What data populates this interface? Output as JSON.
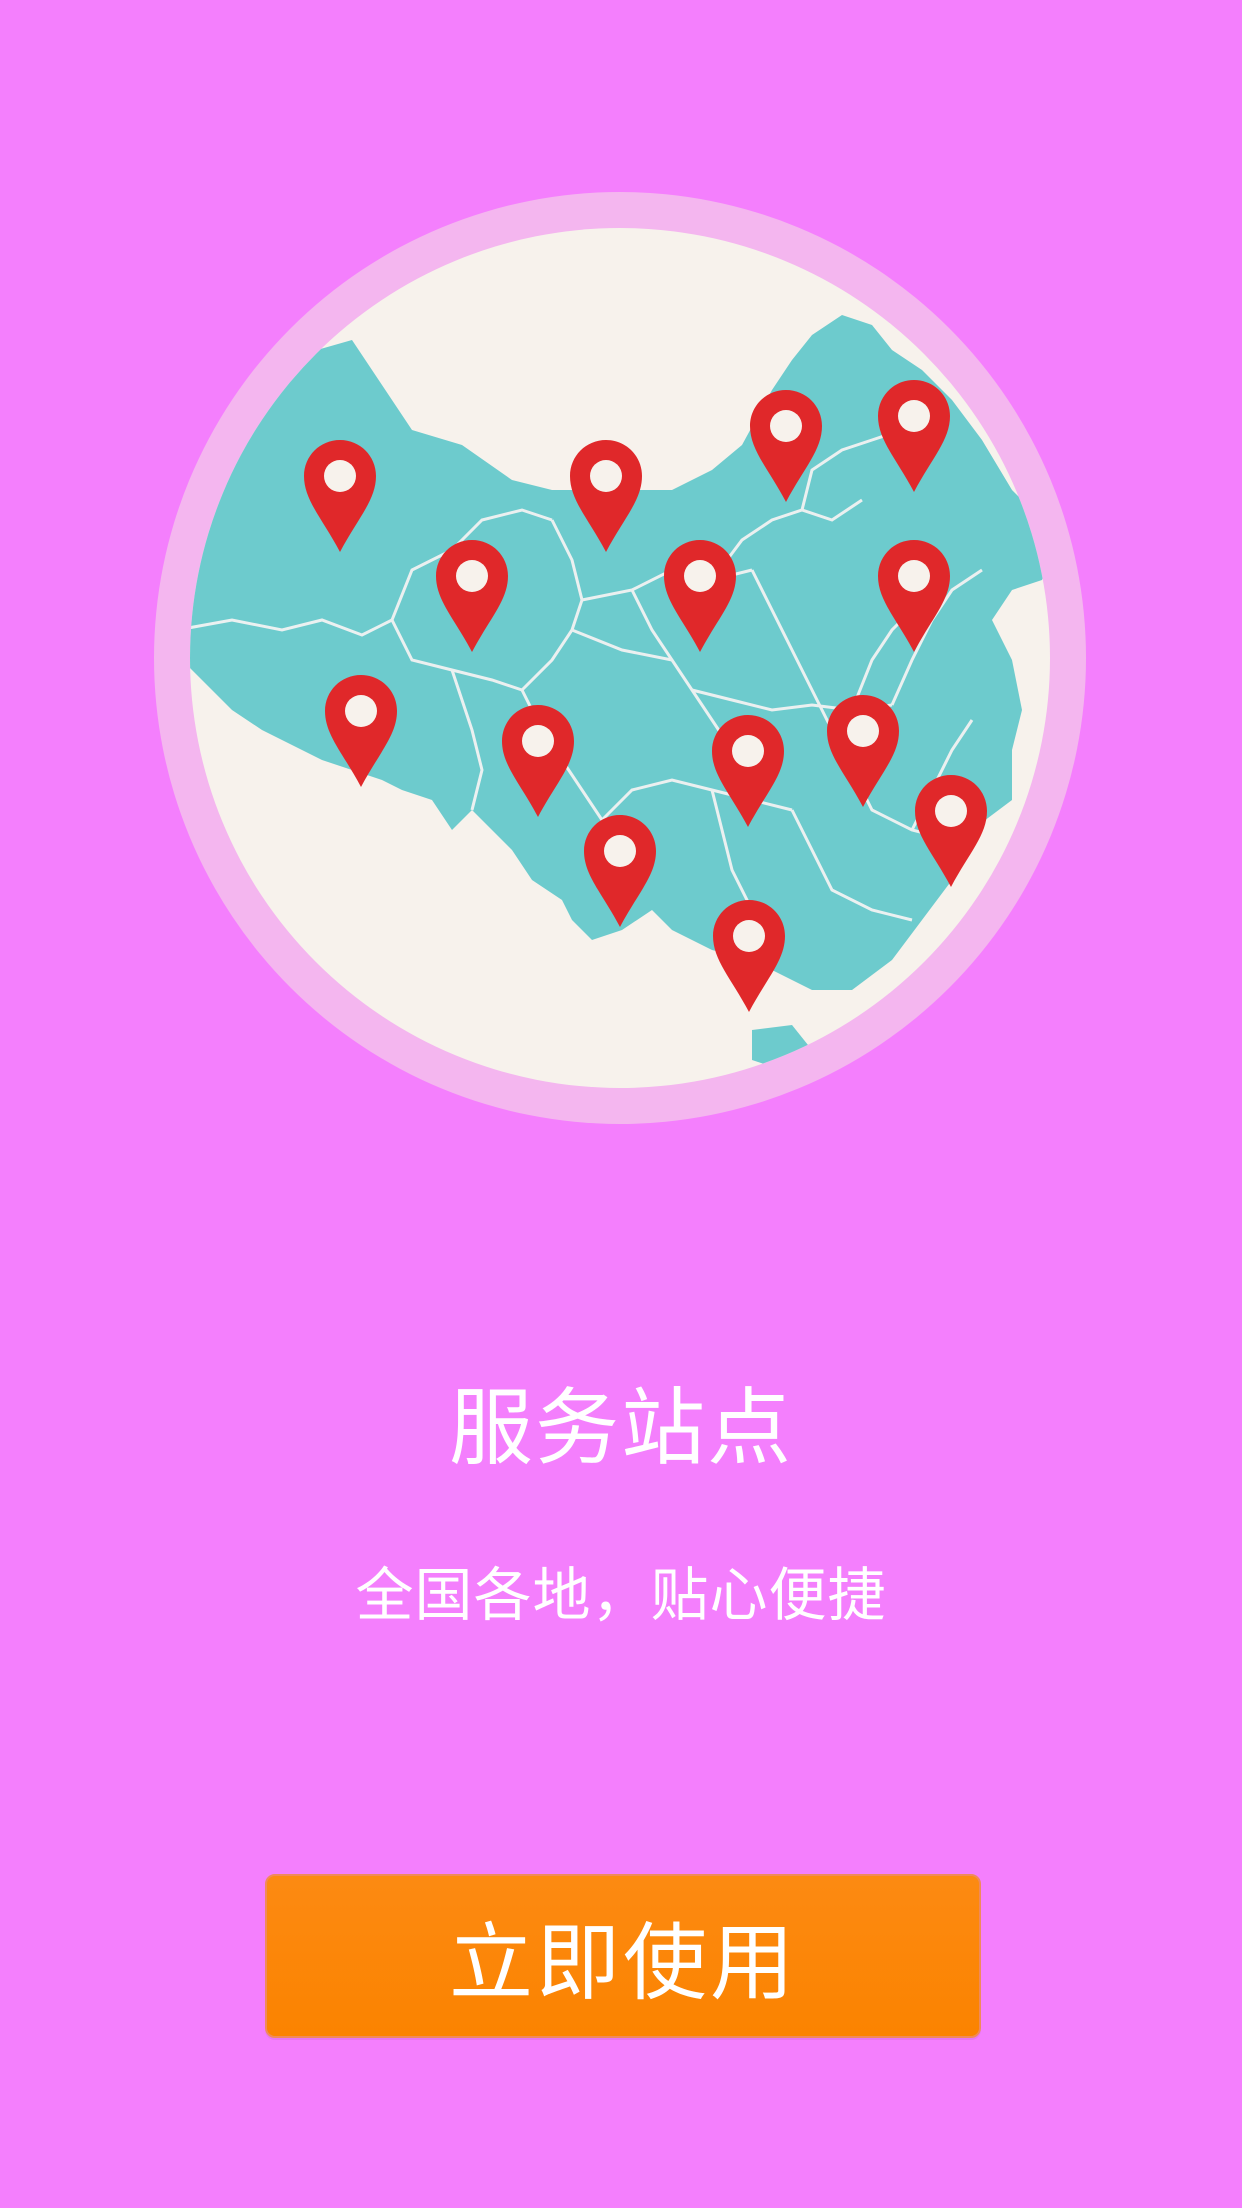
{
  "hero": {
    "illustration": "china-map-with-location-pins",
    "pin_icon": "map-pin-icon",
    "pin_color": "#e0282a",
    "map_color": "#6dcbcd",
    "ring_color": "#f4b6ef",
    "inner_bg": "#f7f2ec"
  },
  "title": "服务站点",
  "subtitle": "全国各地，贴心便捷",
  "button": {
    "label": "立即使用",
    "color": "#fb8500"
  },
  "page_background": "#f47ffd"
}
